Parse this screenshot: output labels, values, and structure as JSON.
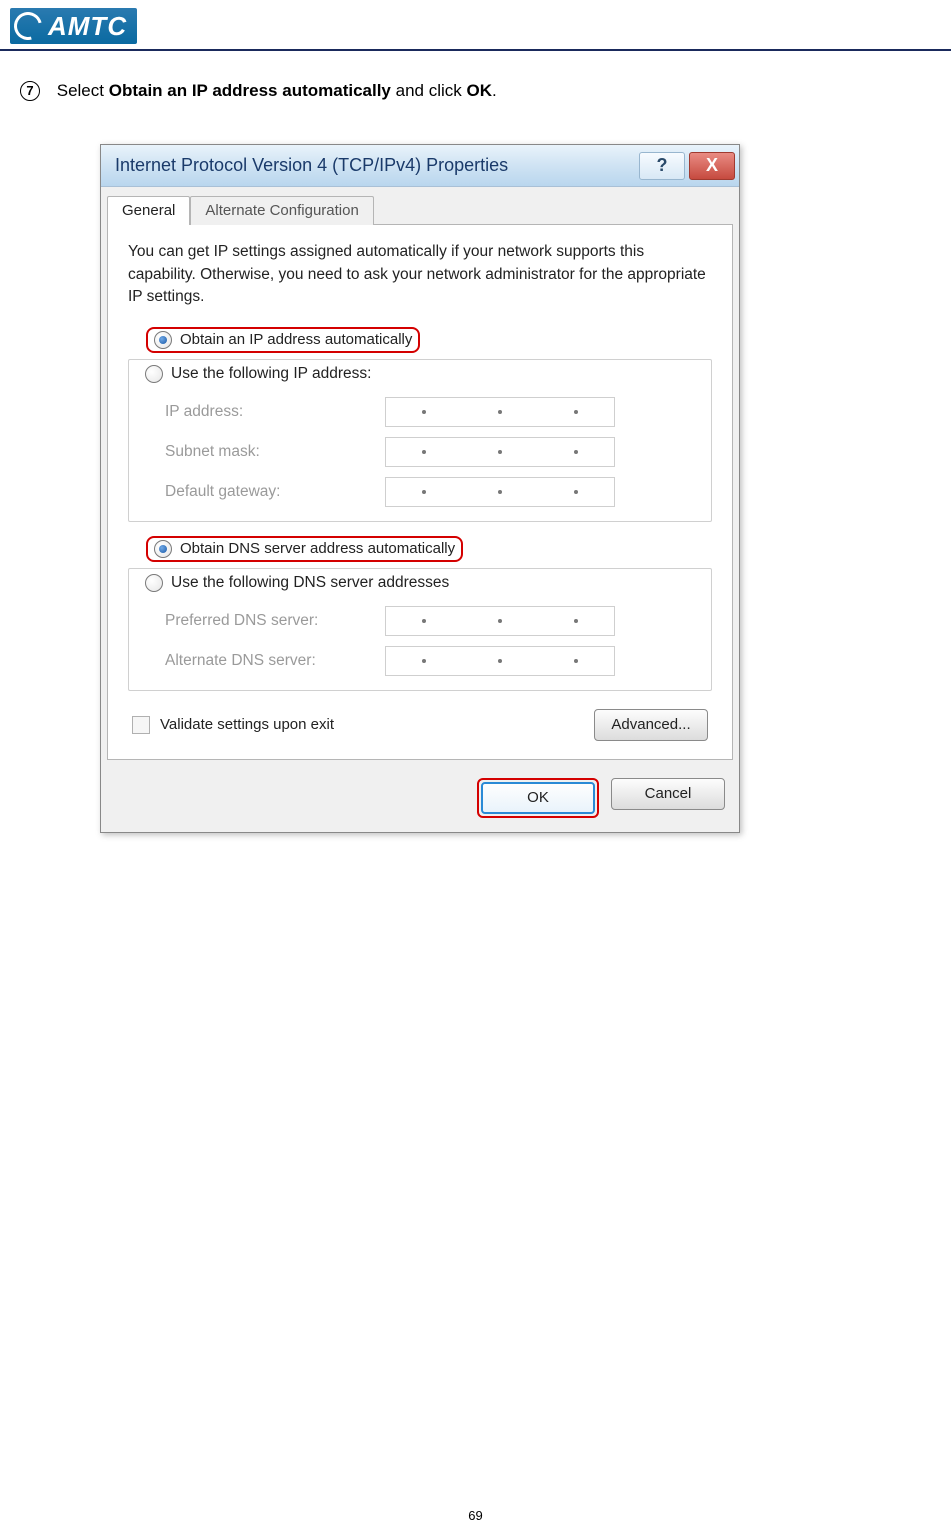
{
  "header": {
    "brand": "AMTC"
  },
  "instruction": {
    "step_number": "7",
    "prefix": "Select ",
    "bold1": "Obtain an IP address automatically",
    "mid": " and click ",
    "bold2": "OK",
    "suffix": "."
  },
  "dialog": {
    "title": "Internet Protocol Version 4 (TCP/IPv4) Properties",
    "help_glyph": "?",
    "close_glyph": "X",
    "tabs": {
      "general": "General",
      "alternate": "Alternate Configuration"
    },
    "intro": "You can get IP settings assigned automatically if your network supports this capability. Otherwise, you need to ask your network administrator for the appropriate IP settings.",
    "ip_section": {
      "auto": "Obtain an IP address automatically",
      "manual": "Use the following IP address:",
      "fields": {
        "ip": "IP address:",
        "subnet": "Subnet mask:",
        "gateway": "Default gateway:"
      }
    },
    "dns_section": {
      "auto": "Obtain DNS server address automatically",
      "manual": "Use the following DNS server addresses",
      "fields": {
        "preferred": "Preferred DNS server:",
        "alternate": "Alternate DNS server:"
      }
    },
    "validate": "Validate settings upon exit",
    "advanced": "Advanced...",
    "ok": "OK",
    "cancel": "Cancel"
  },
  "page_number": "69"
}
